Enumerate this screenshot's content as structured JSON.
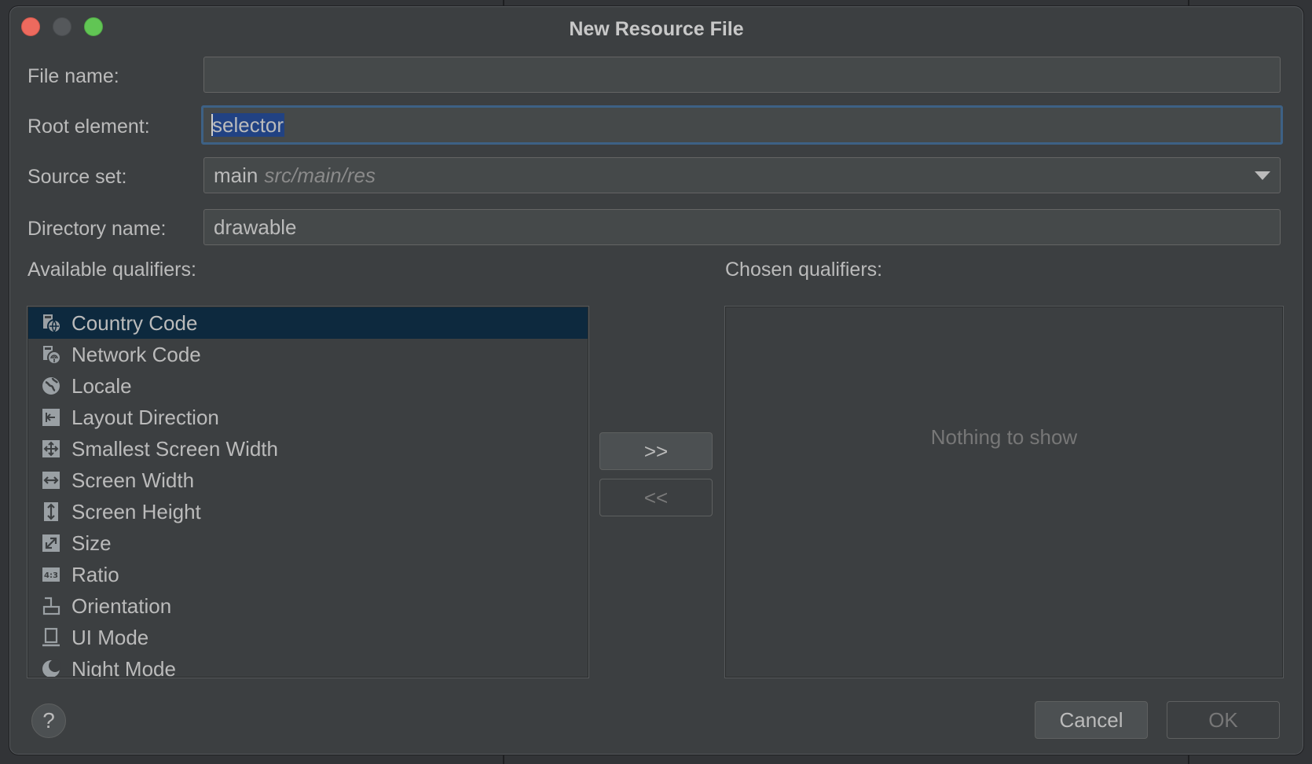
{
  "dialog": {
    "title": "New Resource File"
  },
  "form": {
    "file_name_label": "File name:",
    "file_name_value": "",
    "root_element_label": "Root element:",
    "root_element_value": "selector",
    "source_set_label": "Source set:",
    "source_set_value": "main",
    "source_set_hint": "src/main/res",
    "directory_name_label": "Directory name:",
    "directory_name_value": "drawable"
  },
  "qualifiers": {
    "available_label": "Available qualifiers:",
    "chosen_label": "Chosen qualifiers:",
    "chosen_empty": "Nothing to show",
    "items": [
      {
        "label": "Country Code",
        "icon": "country-code-icon",
        "selected": true
      },
      {
        "label": "Network Code",
        "icon": "network-code-icon",
        "selected": false
      },
      {
        "label": "Locale",
        "icon": "locale-icon",
        "selected": false
      },
      {
        "label": "Layout Direction",
        "icon": "layout-direction-icon",
        "selected": false
      },
      {
        "label": "Smallest Screen Width",
        "icon": "smallest-screen-width-icon",
        "selected": false
      },
      {
        "label": "Screen Width",
        "icon": "screen-width-icon",
        "selected": false
      },
      {
        "label": "Screen Height",
        "icon": "screen-height-icon",
        "selected": false
      },
      {
        "label": "Size",
        "icon": "size-icon",
        "selected": false
      },
      {
        "label": "Ratio",
        "icon": "ratio-icon",
        "selected": false
      },
      {
        "label": "Orientation",
        "icon": "orientation-icon",
        "selected": false
      },
      {
        "label": "UI Mode",
        "icon": "ui-mode-icon",
        "selected": false
      },
      {
        "label": "Night Mode",
        "icon": "night-mode-icon",
        "selected": false
      }
    ]
  },
  "buttons": {
    "add": ">>",
    "remove": "<<",
    "cancel": "Cancel",
    "ok": "OK",
    "help": "?"
  },
  "colors": {
    "window_bg": "#3c3f41",
    "selection_bg": "#0d293e",
    "focus_border": "#3d6185",
    "text_selection": "#214283"
  }
}
